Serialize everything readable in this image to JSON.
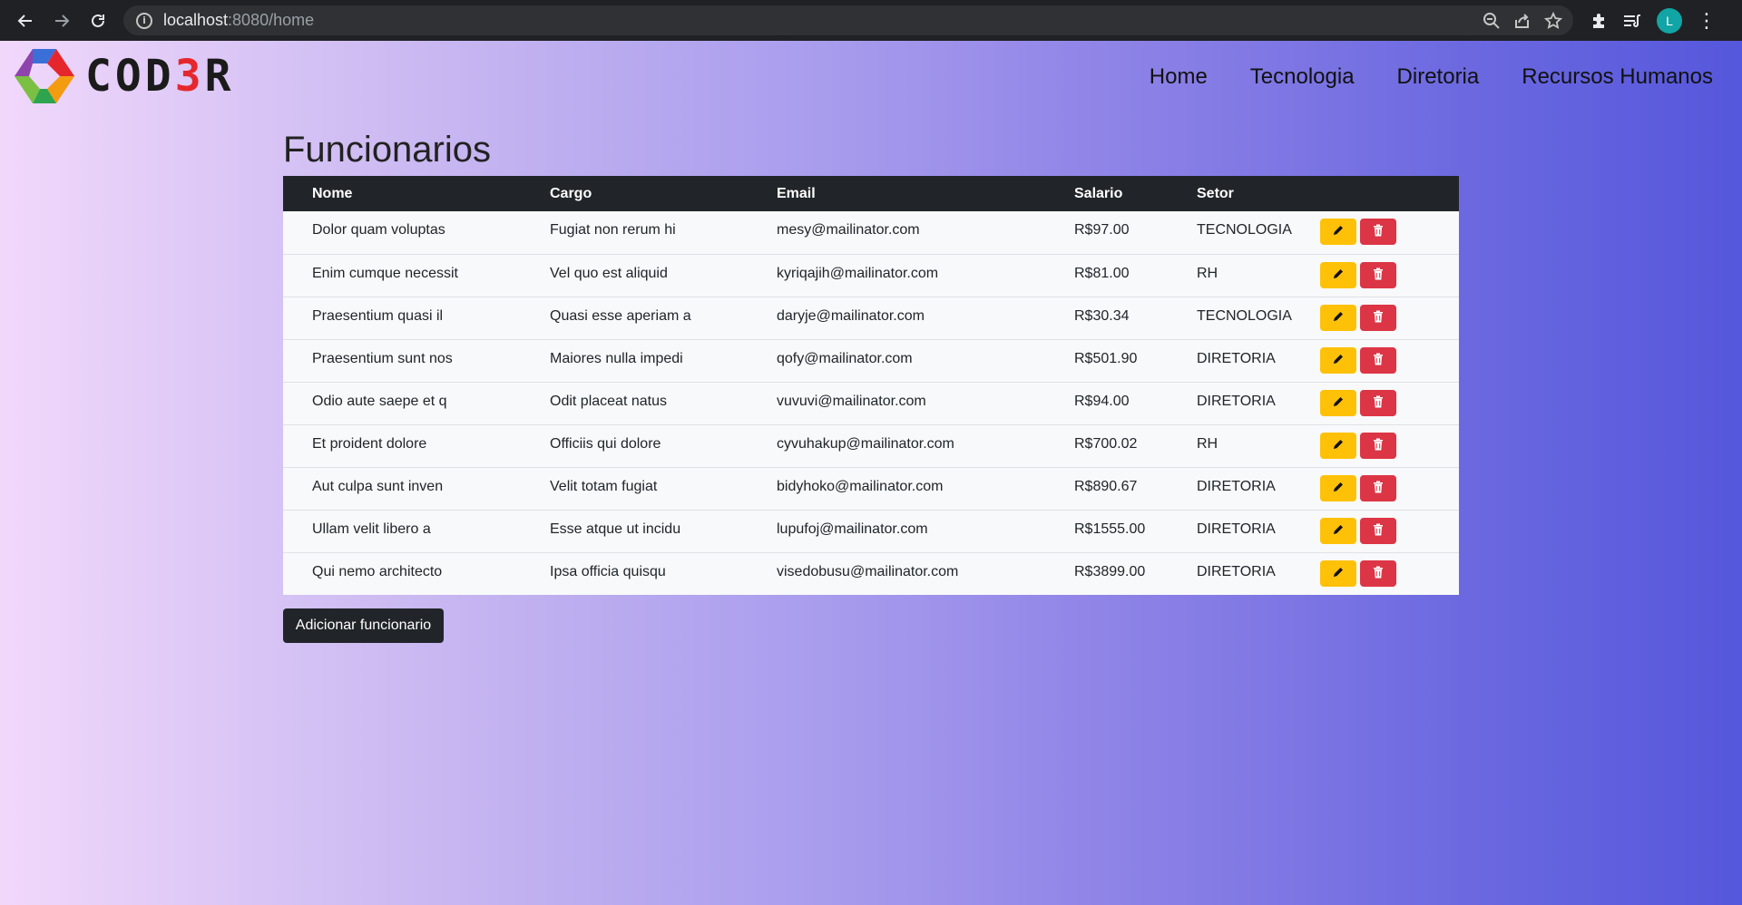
{
  "browser": {
    "url_host": "localhost",
    "url_path": ":8080/home",
    "avatar_letter": "L"
  },
  "brand": {
    "logo_prefix": "COD",
    "logo_accent": "3",
    "logo_suffix": "R"
  },
  "nav": {
    "items": [
      "Home",
      "Tecnologia",
      "Diretoria",
      "Recursos Humanos"
    ]
  },
  "page": {
    "title": "Funcionarios"
  },
  "table": {
    "headers": [
      "Nome",
      "Cargo",
      "Email",
      "Salario",
      "Setor"
    ],
    "rows": [
      {
        "nome": "Dolor quam voluptas",
        "cargo": "Fugiat non rerum hi",
        "email": "mesy@mailinator.com",
        "salario": "R$97.00",
        "setor": "TECNOLOGIA"
      },
      {
        "nome": "Enim cumque necessit",
        "cargo": "Vel quo est aliquid",
        "email": "kyriqajih@mailinator.com",
        "salario": "R$81.00",
        "setor": "RH"
      },
      {
        "nome": "Praesentium quasi il",
        "cargo": "Quasi esse aperiam a",
        "email": "daryje@mailinator.com",
        "salario": "R$30.34",
        "setor": "TECNOLOGIA"
      },
      {
        "nome": "Praesentium sunt nos",
        "cargo": "Maiores nulla impedi",
        "email": "qofy@mailinator.com",
        "salario": "R$501.90",
        "setor": "DIRETORIA"
      },
      {
        "nome": "Odio aute saepe et q",
        "cargo": "Odit placeat natus",
        "email": "vuvuvi@mailinator.com",
        "salario": "R$94.00",
        "setor": "DIRETORIA"
      },
      {
        "nome": "Et proident dolore",
        "cargo": "Officiis qui dolore",
        "email": "cyvuhakup@mailinator.com",
        "salario": "R$700.02",
        "setor": "RH"
      },
      {
        "nome": "Aut culpa sunt inven",
        "cargo": "Velit totam fugiat",
        "email": "bidyhoko@mailinator.com",
        "salario": "R$890.67",
        "setor": "DIRETORIA"
      },
      {
        "nome": "Ullam velit libero a",
        "cargo": "Esse atque ut incidu",
        "email": "lupufoj@mailinator.com",
        "salario": "R$1555.00",
        "setor": "DIRETORIA"
      },
      {
        "nome": "Qui nemo architecto",
        "cargo": "Ipsa officia quisqu",
        "email": "visedobusu@mailinator.com",
        "salario": "R$3899.00",
        "setor": "DIRETORIA"
      }
    ],
    "row_actions": {
      "edit_icon": "pencil-icon",
      "delete_icon": "trash-icon"
    }
  },
  "actions": {
    "add_label": "Adicionar funcionario"
  },
  "colors": {
    "edit": "#ffc107",
    "delete": "#dc3545",
    "header_dark": "#212529",
    "logo_red": "#e5272d"
  }
}
